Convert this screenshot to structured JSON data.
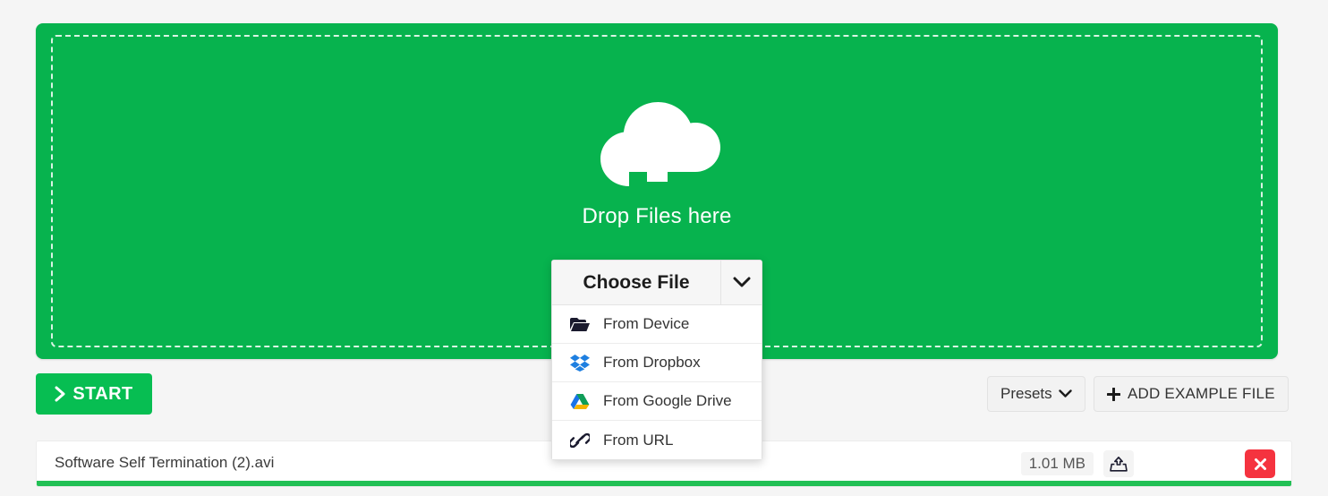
{
  "dropzone": {
    "label": "Drop Files here",
    "icon": "cloud-upload-icon",
    "background_color": "#07b34e"
  },
  "chooser": {
    "title": "Choose File",
    "caret_icon": "chevron-down-icon",
    "items": [
      {
        "label": "From Device",
        "icon": "folder-open-icon"
      },
      {
        "label": "From Dropbox",
        "icon": "dropbox-icon"
      },
      {
        "label": "From Google Drive",
        "icon": "google-drive-icon"
      },
      {
        "label": "From URL",
        "icon": "link-icon"
      }
    ]
  },
  "actions": {
    "start_label": "START",
    "start_icon": "chevron-right-icon",
    "start_color": "#07be52",
    "presets_label": "Presets",
    "presets_caret_icon": "chevron-down-icon",
    "add_example_label": "ADD EXAMPLE FILE",
    "add_example_icon": "plus-icon"
  },
  "file": {
    "name": "Software Self Termination (2).avi",
    "size": "1.01 MB",
    "upload_icon": "upload-tray-icon",
    "remove_icon": "close-icon",
    "remove_color": "#f5333f",
    "progress_percent": 100,
    "progress_color": "#22c055"
  }
}
